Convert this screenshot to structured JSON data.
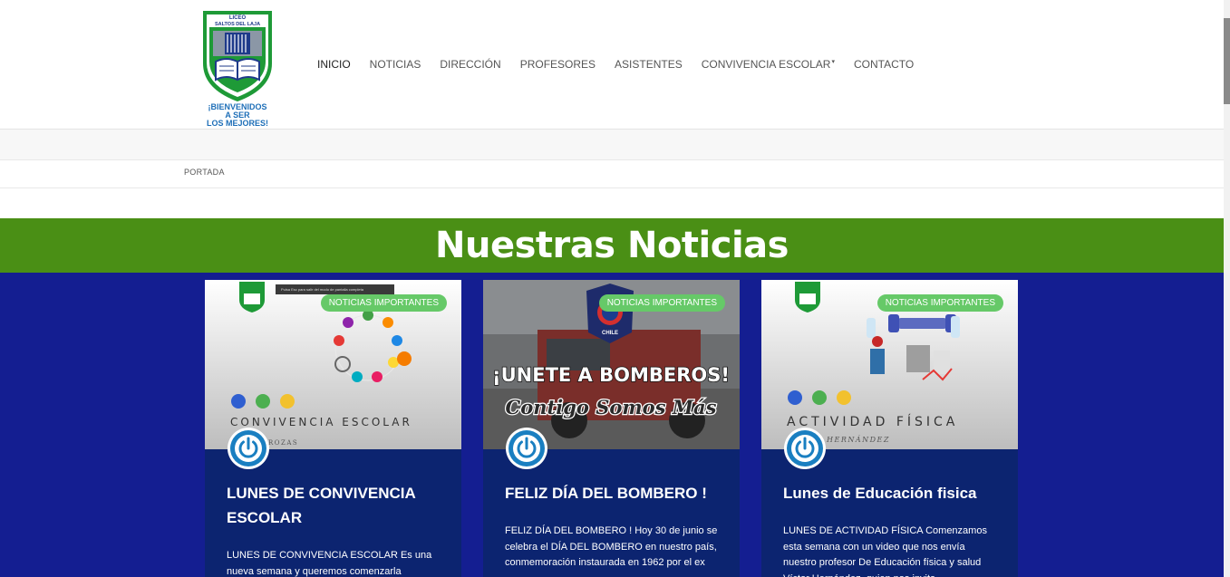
{
  "logo": {
    "top_text": "LICEO",
    "name": "SALTOS DEL LAJA",
    "motto_line1": "¡BIENVENIDOS",
    "motto_line2": "A SER",
    "motto_line3": "LOS MEJORES!"
  },
  "nav": {
    "items": [
      "INICIO",
      "NOTICIAS",
      "DIRECCIÓN",
      "PROFESORES",
      "ASISTENTES",
      "CONVIVENCIA ESCOLAR",
      "CONTACTO"
    ],
    "active_index": 0
  },
  "breadcrumb": "PORTADA",
  "section_title": "Nuestras Noticias",
  "cards": [
    {
      "badge": "NOTICIAS IMPORTANTES",
      "image_text": "CONVIVENCIA ESCOLAR",
      "image_subtext": "ROZAS",
      "tooltip": "Pulsa Esc para salir del modo de pantalla completa",
      "title": "LUNES DE CONVIVENCIA ESCOLAR",
      "excerpt": "LUNES DE CONVIVENCIA ESCOLAR Es una nueva semana y queremos comenzarla"
    },
    {
      "badge": "NOTICIAS IMPORTANTES",
      "image_text": "¡UNETE A BOMBEROS!",
      "image_subtext": "Contigo Somos Más",
      "emblem_text": "CHILE",
      "title": "FELIZ DÍA DEL BOMBERO !",
      "excerpt": "FELIZ DÍA DEL BOMBERO ! Hoy 30 de junio se celebra el DÍA DEL BOMBERO en nuestro país, conmemoración instaurada en 1962 por el ex"
    },
    {
      "badge": "NOTICIAS IMPORTANTES",
      "image_text": "ACTIVIDAD FÍSICA",
      "image_subtext": "HERNÁNDEZ",
      "title": "Lunes de Educación fisica",
      "excerpt": "LUNES DE ACTIVIDAD FÍSICA Comenzamos esta semana con un video que nos envía nuestro profesor De Educación física y salud Víctor Hernández, quien nos invita"
    }
  ],
  "colors": {
    "green_band": "#4a8f15",
    "blue_section": "#141e91",
    "card_bg": "#0c2470",
    "badge": "#66c968"
  },
  "icons": {
    "card_author": "power-icon"
  }
}
